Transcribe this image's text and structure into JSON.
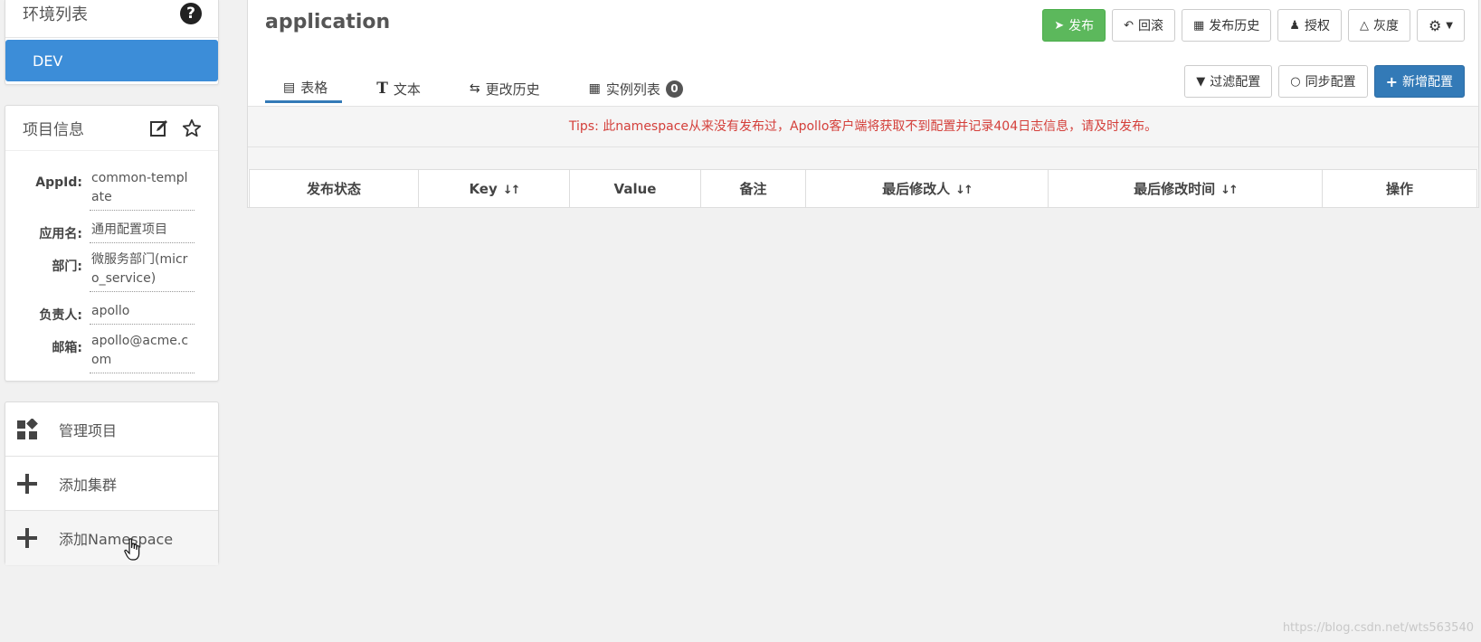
{
  "env": {
    "title": "环境列表",
    "items": [
      "DEV"
    ]
  },
  "project": {
    "title": "项目信息",
    "fields": [
      {
        "label": "AppId:",
        "value": "common-template"
      },
      {
        "label": "应用名:",
        "value": "通用配置项目"
      },
      {
        "label": "部门:",
        "value": "微服务部门(micro_service)"
      },
      {
        "label": "负责人:",
        "value": "apollo"
      },
      {
        "label": "邮箱:",
        "value": "apollo@acme.com"
      }
    ]
  },
  "menu": {
    "items": [
      "管理项目",
      "添加集群",
      "添加Namespace"
    ]
  },
  "namespace": {
    "title": "application"
  },
  "toolbar": {
    "publish": "发布",
    "rollback": "回滚",
    "history": "发布历史",
    "auth": "授权",
    "gray": "灰度"
  },
  "tabs": {
    "table": "表格",
    "text": "文本",
    "history": "更改历史",
    "instances": "实例列表",
    "instance_count": "0"
  },
  "actions": {
    "filter": "过滤配置",
    "sync": "同步配置",
    "add": "新增配置"
  },
  "tips": "Tips: 此namespace从来没有发布过，Apollo客户端将获取不到配置并记录404日志信息，请及时发布。",
  "table": {
    "headers": [
      "发布状态",
      "Key",
      "Value",
      "备注",
      "最后修改人",
      "最后修改时间",
      "操作"
    ]
  },
  "watermark": "https://blog.csdn.net/wts563540"
}
